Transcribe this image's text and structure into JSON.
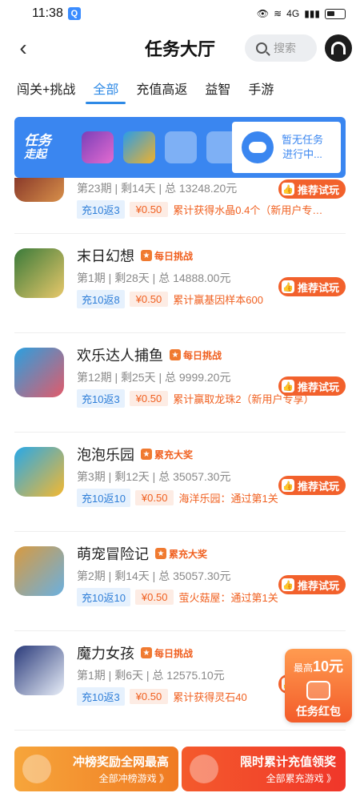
{
  "status": {
    "time": "11:38",
    "badge": "Q",
    "network": "4G"
  },
  "header": {
    "title": "任务大厅",
    "search_placeholder": "搜索"
  },
  "tabs": [
    {
      "label": "闯关+挑战",
      "active": false
    },
    {
      "label": "全部",
      "active": true
    },
    {
      "label": "充值高返",
      "active": false
    },
    {
      "label": "益智",
      "active": false
    },
    {
      "label": "手游",
      "active": false
    }
  ],
  "banner": {
    "logo_line1": "任务",
    "logo_line2": "走起",
    "status_line1": "暂无任务",
    "status_line2": "进行中..."
  },
  "games": [
    {
      "name": "",
      "tag": "",
      "meta": "第23期 | 剩14天 | 总 13248.20元",
      "chip1": "充10返3",
      "chip2": "¥0.50",
      "reward": "累计获得水晶0.4个（新用户专…",
      "action": "推荐试玩",
      "color1": "#8a3a2a",
      "color2": "#d8904a"
    },
    {
      "name": "末日幻想",
      "tag": "每日挑战",
      "meta": "第1期 | 剩28天 | 总 14888.00元",
      "chip1": "充10返8",
      "chip2": "¥0.50",
      "reward": "累计赢基因样本600",
      "action": "推荐试玩",
      "color1": "#3a7a3a",
      "color2": "#e8c86a"
    },
    {
      "name": "欢乐达人捕鱼",
      "tag": "每日挑战",
      "meta": "第12期 | 剩25天 | 总 9999.20元",
      "chip1": "充10返3",
      "chip2": "¥0.50",
      "reward": "累计赢取龙珠2（新用户专享）",
      "action": "推荐试玩",
      "color1": "#2aa0e0",
      "color2": "#e25a6a"
    },
    {
      "name": "泡泡乐园",
      "tag": "累充大奖",
      "meta": "第3期 | 剩12天 | 总 35057.30元",
      "chip1": "充10返10",
      "chip2": "¥0.50",
      "reward": "海洋乐园：通过第1关",
      "action": "推荐试玩",
      "color1": "#28a8e8",
      "color2": "#f4b830"
    },
    {
      "name": "萌宠冒险记",
      "tag": "累充大奖",
      "meta": "第2期 | 剩14天 | 总 35057.30元",
      "chip1": "充10返10",
      "chip2": "¥0.50",
      "reward": "萤火菇屋：通过第1关",
      "action": "推荐试玩",
      "color1": "#d89a40",
      "color2": "#6ab0e0"
    },
    {
      "name": "魔力女孩",
      "tag": "每日挑战",
      "meta": "第1期 | 剩6天 | 总 12575.10元",
      "chip1": "充10返3",
      "chip2": "¥0.50",
      "reward": "累计获得灵石40",
      "action": "推荐试玩",
      "color1": "#2a3a7a",
      "color2": "#e8eef8"
    }
  ],
  "redpack": {
    "prefix": "最高",
    "amount": "10元",
    "label": "任务红包"
  },
  "bottom": [
    {
      "title": "冲榜奖励全网最高",
      "sub": "全部冲榜游戏 》"
    },
    {
      "title": "限时累计充值领奖",
      "sub": "全部累充游戏 》"
    }
  ]
}
